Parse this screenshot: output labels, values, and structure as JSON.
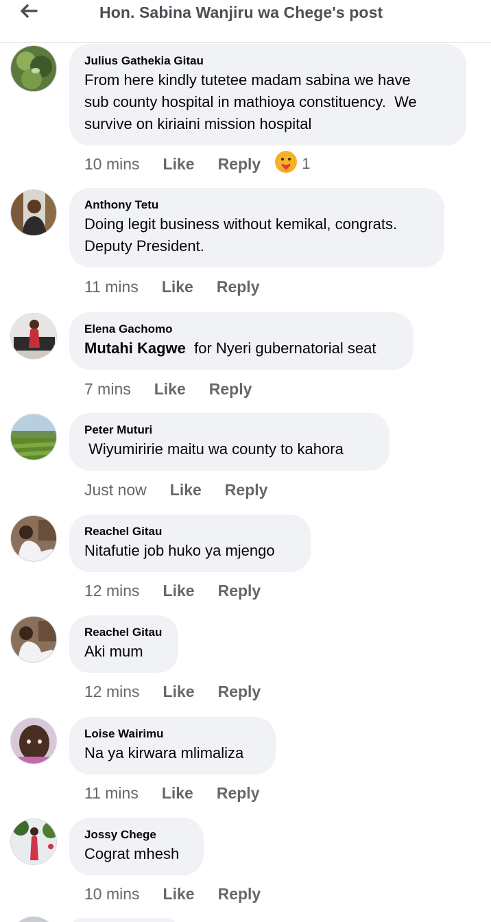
{
  "header": {
    "title": "Hon. Sabina Wanjiru wa Chege's post",
    "back_icon": "back-arrow-icon"
  },
  "actions": {
    "like": "Like",
    "reply": "Reply"
  },
  "comments": [
    {
      "author": "Julius Gathekia Gitau",
      "text": "From here kindly tutetee madam sabina we have\nsub county hospital in mathioya constituency.  We\nsurvive on kiriaini mission hospital",
      "time": "10 mins",
      "reaction": {
        "icon": "care-emoji-icon",
        "count": "1"
      }
    },
    {
      "author": "Anthony Tetu",
      "text": "Doing legit business without kemikal, congrats.\nDeputy President.",
      "time": "11 mins"
    },
    {
      "author": "Elena Gachomo",
      "mention": "Mutahi Kagwe",
      "text": "  for Nyeri gubernatorial seat",
      "time": "7 mins"
    },
    {
      "author": "Peter Muturi",
      "text": " Wiyumiririe maitu wa county to kahora",
      "time": "Just now"
    },
    {
      "author": "Reachel Gitau",
      "text": "Nitafutie job huko ya mjengo",
      "time": "12 mins"
    },
    {
      "author": "Reachel Gitau",
      "text": "Aki mum",
      "time": "12 mins"
    },
    {
      "author": "Loise Wairimu",
      "text": "Na ya kirwara mlimaliza",
      "time": "11 mins"
    },
    {
      "author": "Jossy Chege",
      "text": "Cograt mhesh",
      "time": "10 mins"
    }
  ]
}
